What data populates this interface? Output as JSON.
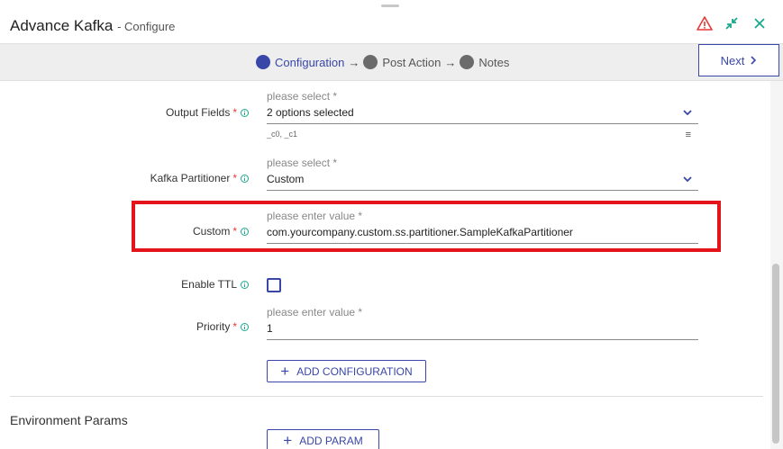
{
  "header": {
    "title": "Advance Kafka",
    "subtitle": "- Configure",
    "icons": [
      "warning-icon",
      "collapse-icon",
      "close-icon"
    ]
  },
  "stepper": {
    "steps": [
      {
        "label": "Configuration",
        "active": true
      },
      {
        "label": "Post Action",
        "active": false
      },
      {
        "label": "Notes",
        "active": false
      }
    ],
    "arrow": "→",
    "next_label": "Next"
  },
  "form": {
    "output_fields": {
      "label": "Output Fields",
      "placeholder": "please select *",
      "value": "2 options selected",
      "hint": "_c0, _c1"
    },
    "kafka_partitioner": {
      "label": "Kafka Partitioner",
      "placeholder": "please select *",
      "value": "Custom"
    },
    "custom": {
      "label": "Custom",
      "placeholder": "please enter value *",
      "value": "com.yourcompany.custom.ss.partitioner.SampleKafkaPartitioner"
    },
    "enable_ttl": {
      "label": "Enable TTL",
      "checked": false
    },
    "priority": {
      "label": "Priority",
      "placeholder": "please enter value *",
      "value": "1"
    },
    "required_mark": "*",
    "add_configuration_label": "ADD CONFIGURATION"
  },
  "environment": {
    "title": "Environment Params",
    "add_param_label": "ADD PARAM"
  },
  "colors": {
    "accent": "#3947a8",
    "highlight": "#e3151a",
    "required": "#e53935",
    "info": "#1aa88c"
  }
}
